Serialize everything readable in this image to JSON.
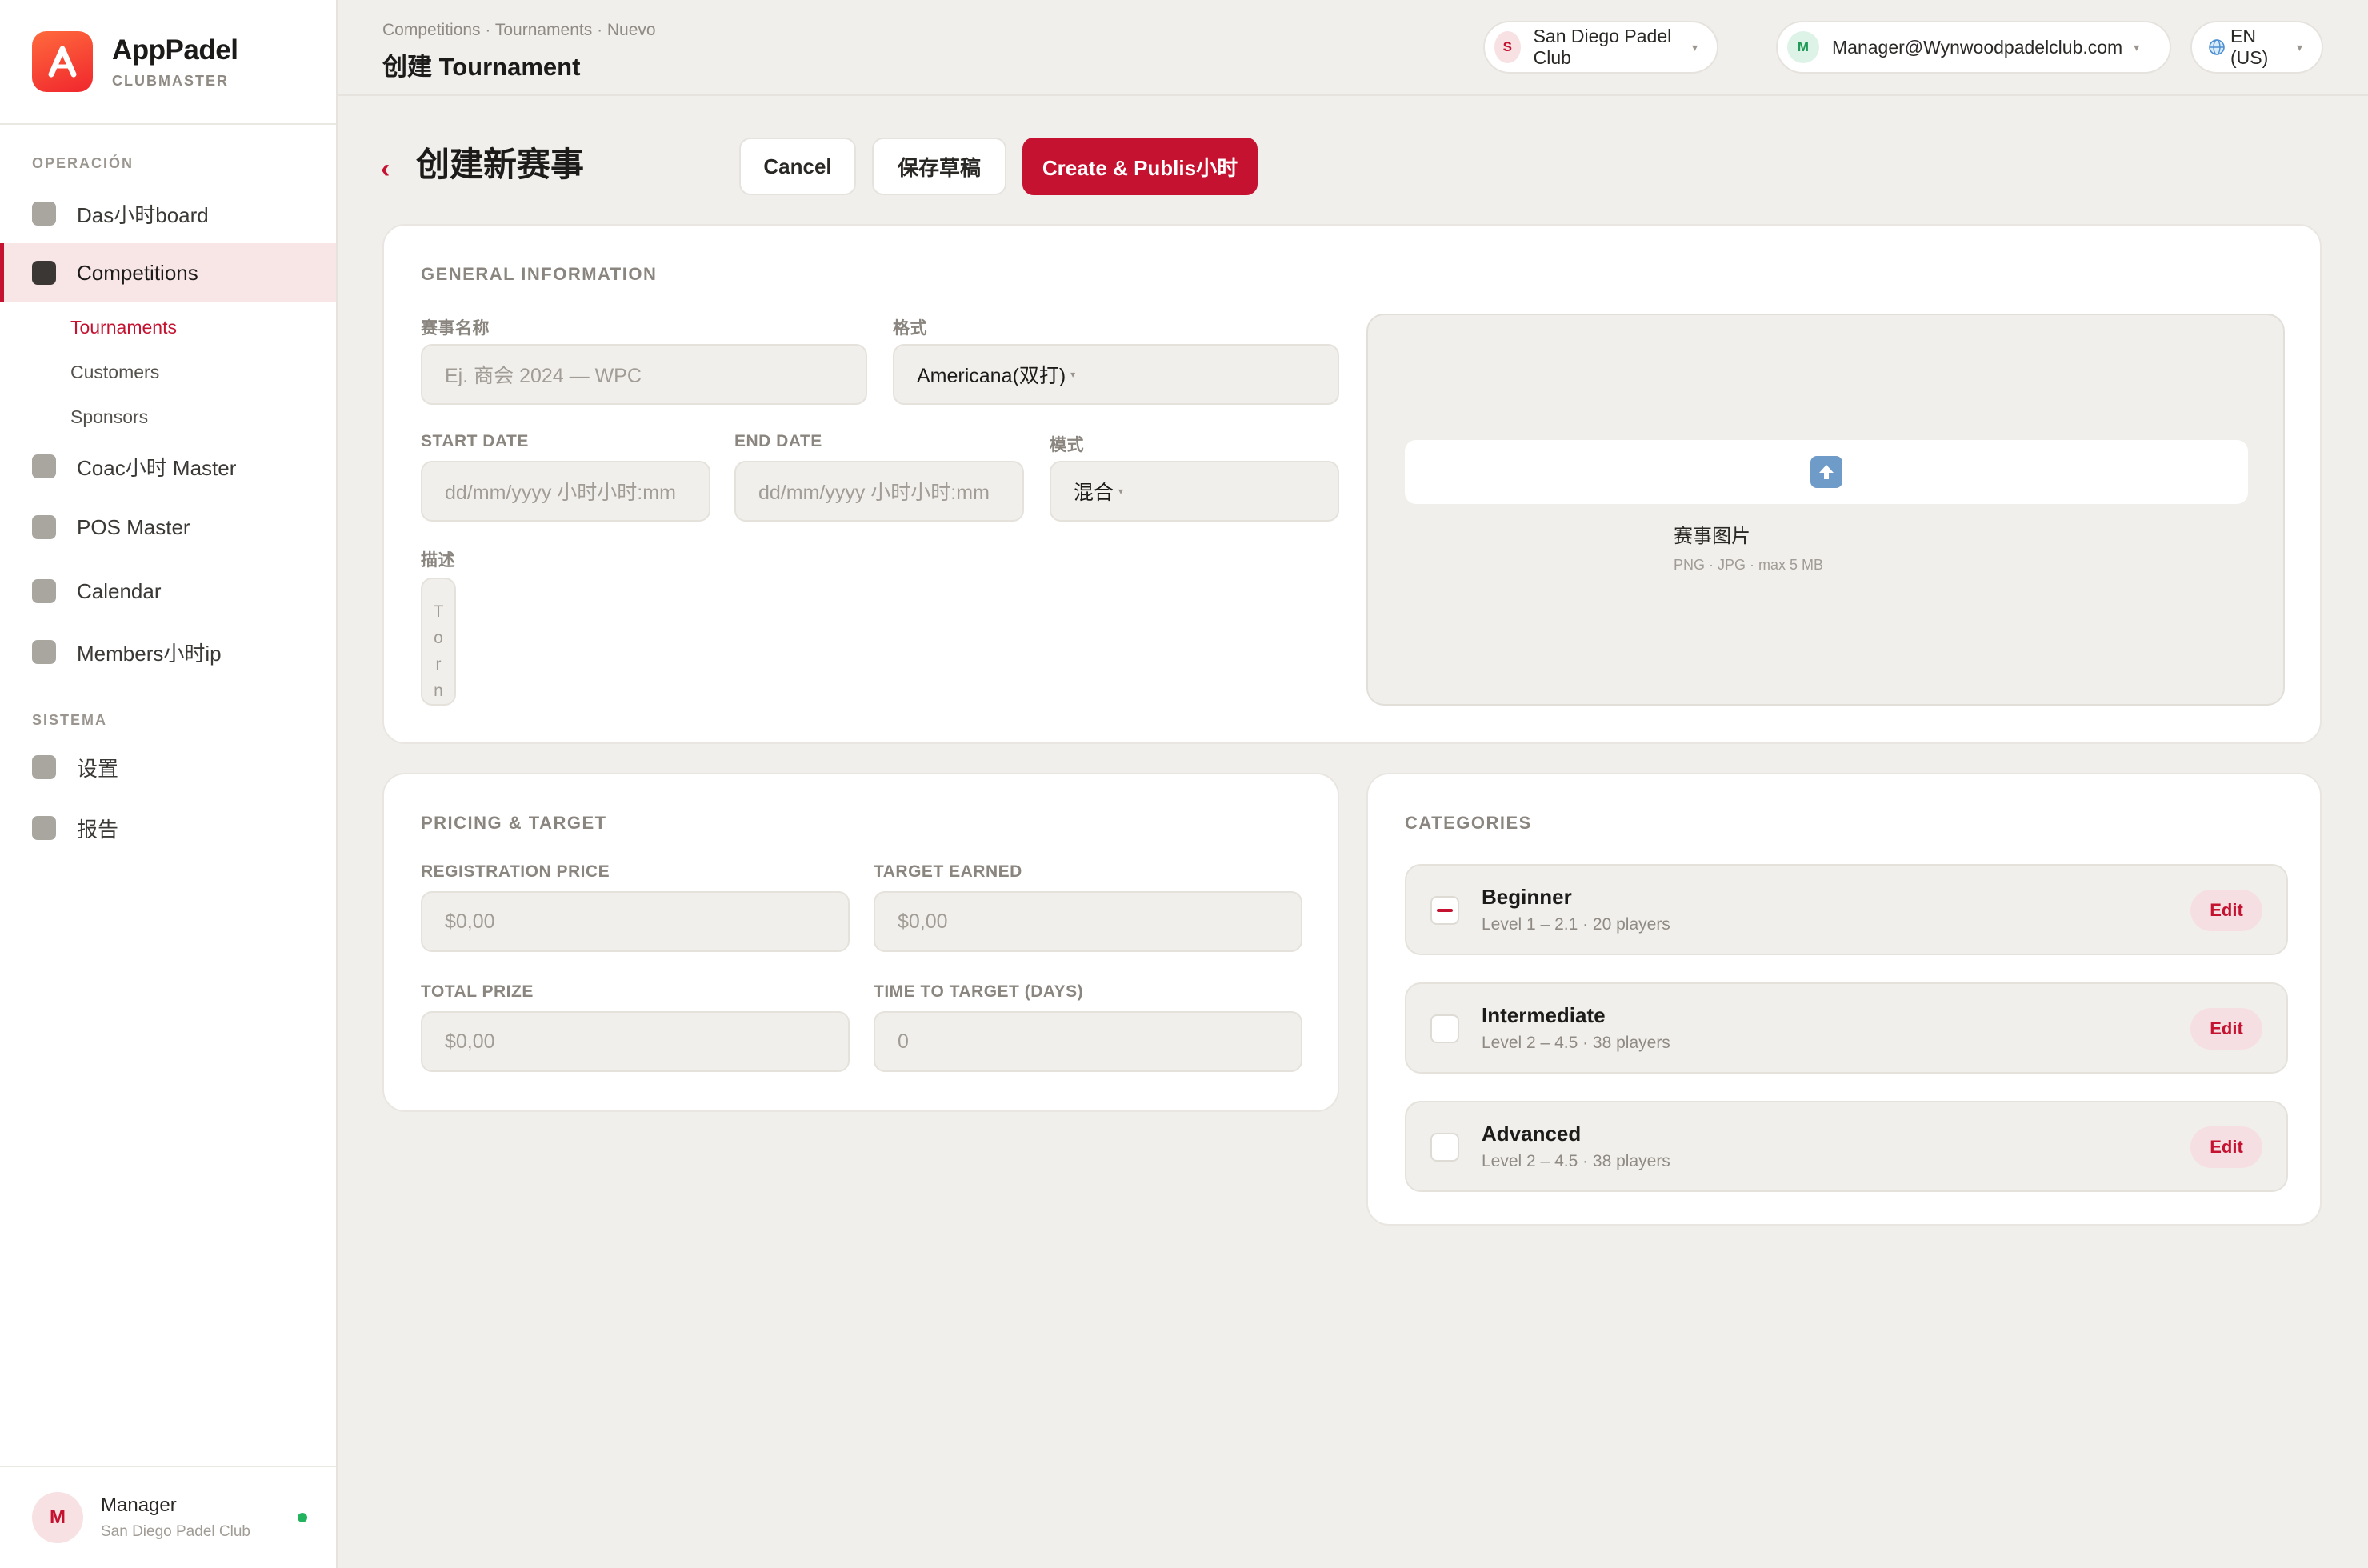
{
  "brand": {
    "name": "AppPadel",
    "subtitle": "CLUBMASTER"
  },
  "sidebar": {
    "section_operation": "OPERACIÓN",
    "section_system": "SISTEMA",
    "items": [
      {
        "label": "Das小时board",
        "icon": "square-icon"
      },
      {
        "label": "Competitions",
        "icon": "square-icon",
        "active": true
      },
      {
        "label": "Coac小时 Master",
        "icon": "square-icon"
      },
      {
        "label": "POS Master",
        "icon": "square-icon"
      },
      {
        "label": "Calendar",
        "icon": "square-icon"
      },
      {
        "label": "Members小时ip",
        "icon": "square-icon"
      }
    ],
    "sub_items": [
      {
        "label": "Tournaments",
        "active": true
      },
      {
        "label": "Customers"
      },
      {
        "label": "Sponsors"
      }
    ],
    "system_items": [
      {
        "label": "设置",
        "icon": "square-icon"
      },
      {
        "label": "报告",
        "icon": "square-icon"
      }
    ],
    "user": {
      "initial": "M",
      "name": "Manager",
      "club": "San Diego Padel Club",
      "status": "online"
    }
  },
  "topbar": {
    "breadcrumb": "Competitions · Tournaments · Nuevo",
    "title": "创建 Tournament",
    "club": {
      "initial": "S",
      "label": "San Diego Padel Club"
    },
    "account": {
      "initial": "M",
      "label": "Manager@Wynwoodpadelclub.com"
    },
    "language": {
      "icon": "globe-icon",
      "label": "EN (US)"
    }
  },
  "header": {
    "back_icon": "chevron-left-icon",
    "title": "创建新赛事",
    "cancel_label": "Cancel",
    "draft_label": "保存草稿",
    "publish_label": "Create & Publis小时"
  },
  "general": {
    "title": "GENERAL INFORMATION",
    "name_label": "赛事名称",
    "name_placeholder": "Ej. 商会 2024 — WPC",
    "format_label": "格式",
    "format_value": "Americana(双打)",
    "start_label": "START DATE",
    "start_placeholder": "dd/mm/yyyy 小时小时:mm",
    "end_label": "END DATE",
    "end_placeholder": "dd/mm/yyyy 小时小时:mm",
    "mode_label": "模式",
    "mode_value": "混合",
    "desc_label": "描述",
    "desc_placeholder_chars": [
      "T",
      "o",
      "r",
      "n"
    ],
    "upload_icon": "upload-arrow-icon",
    "upload_label": "赛事图片",
    "upload_hint": "PNG · JPG · max 5 MB"
  },
  "pricing": {
    "title": "PRICING & TARGET",
    "reg_label": "REGISTRATION PRICE",
    "reg_value": "$0,00",
    "target_label": "TARGET EARNED",
    "target_value": "$0,00",
    "prize_label": "TOTAL PRIZE",
    "prize_value": "$0,00",
    "days_label": "TIME TO TARGET (DAYS)",
    "days_value": "0"
  },
  "categories": {
    "title": "CATEGORIES",
    "edit_label": "Edit",
    "items": [
      {
        "name": "Beginner",
        "meta": "Level 1 – 2.1 · 20 players",
        "checked": "indeterminate"
      },
      {
        "name": "Intermediate",
        "meta": "Level 2 – 4.5 · 38 players",
        "checked": false
      },
      {
        "name": "Advanced",
        "meta": "Level 2 – 4.5 · 38 players",
        "checked": false
      }
    ]
  },
  "colors": {
    "accent": "#c41230",
    "background": "#f1efeb",
    "card": "#ffffff"
  }
}
